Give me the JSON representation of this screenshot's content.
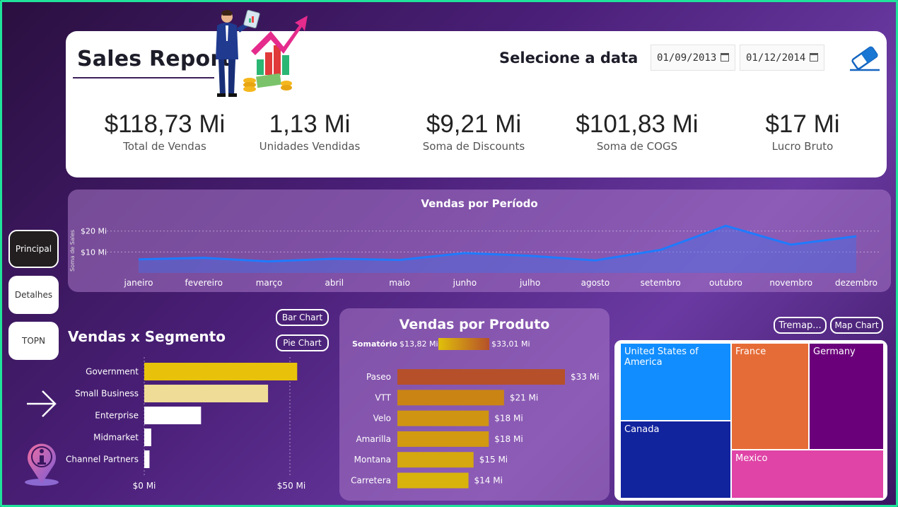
{
  "header": {
    "title": "Sales Report",
    "date_label": "Selecione a data",
    "date_start": "01/09/2013",
    "date_end": "01/12/2014",
    "clear_icon": "eraser-icon"
  },
  "kpis": [
    {
      "value": "$118,73 Mi",
      "label": "Total de Vendas"
    },
    {
      "value": "1,13 Mi",
      "label": "Unidades Vendidas"
    },
    {
      "value": "$9,21 Mi",
      "label": "Soma de Discounts"
    },
    {
      "value": "$101,83 Mi",
      "label": "Soma de COGS"
    },
    {
      "value": "$17 Mi",
      "label": "Lucro Bruto"
    }
  ],
  "nav": {
    "principal": "Principal",
    "detalhes": "Detalhes",
    "topn": "TOPN"
  },
  "segment": {
    "title": "Vendas x Segmento",
    "bar_chart_btn": "Bar Chart",
    "pie_chart_btn": "Pie Chart"
  },
  "product": {
    "title": "Vendas por Produto",
    "legend_label": "Somatório",
    "legend_min": "$13,82 Mi",
    "legend_max": "$33,01 Mi"
  },
  "treemap": {
    "treemap_btn": "Tremap...",
    "map_btn": "Map Chart",
    "tiles": [
      {
        "label": "United States of America",
        "color": "#118dff"
      },
      {
        "label": "France",
        "color": "#e66c37"
      },
      {
        "label": "Germany",
        "color": "#6b007b"
      },
      {
        "label": "Canada",
        "color": "#12239e"
      },
      {
        "label": "Mexico",
        "color": "#e044a7"
      }
    ]
  },
  "chart_data": [
    {
      "type": "area",
      "title": "Vendas por Período",
      "ylabel": "Soma de Sales",
      "categories": [
        "janeiro",
        "fevereiro",
        "março",
        "abril",
        "maio",
        "junho",
        "julho",
        "agosto",
        "setembro",
        "outubro",
        "novembro",
        "dezembro"
      ],
      "values": [
        6.5,
        7.2,
        5.5,
        6.8,
        6.2,
        9.5,
        8.2,
        6.0,
        11.0,
        22.5,
        13.5,
        17.5
      ],
      "yticks": [
        "$10 Mi",
        "$20 Mi"
      ],
      "ylim": [
        0,
        28
      ],
      "color": "#1e7bff"
    },
    {
      "type": "bar",
      "orientation": "horizontal",
      "categories": [
        "Government",
        "Small Business",
        "Enterprise",
        "Midmarket",
        "Channel Partners"
      ],
      "values": [
        52.5,
        42.5,
        19.5,
        2.4,
        1.8
      ],
      "colors": [
        "#e8c20a",
        "#efdc96",
        "#ffffff",
        "#ffffff",
        "#ffffff"
      ],
      "xticks": [
        "$0 Mi",
        "$50 Mi"
      ],
      "xlim": [
        0,
        60
      ]
    },
    {
      "type": "bar",
      "orientation": "horizontal",
      "categories": [
        "Paseo",
        "VTT",
        "Velo",
        "Amarilla",
        "Montana",
        "Carretera"
      ],
      "values": [
        33,
        21,
        18,
        18,
        15,
        14
      ],
      "value_labels": [
        "$33 Mi",
        "$21 Mi",
        "$18 Mi",
        "$18 Mi",
        "$15 Mi",
        "$14 Mi"
      ],
      "colors": [
        "#b5502a",
        "#c98414",
        "#cf9512",
        "#d19a10",
        "#d4a80e",
        "#d8b30c"
      ],
      "xlim": [
        0,
        33
      ]
    }
  ]
}
